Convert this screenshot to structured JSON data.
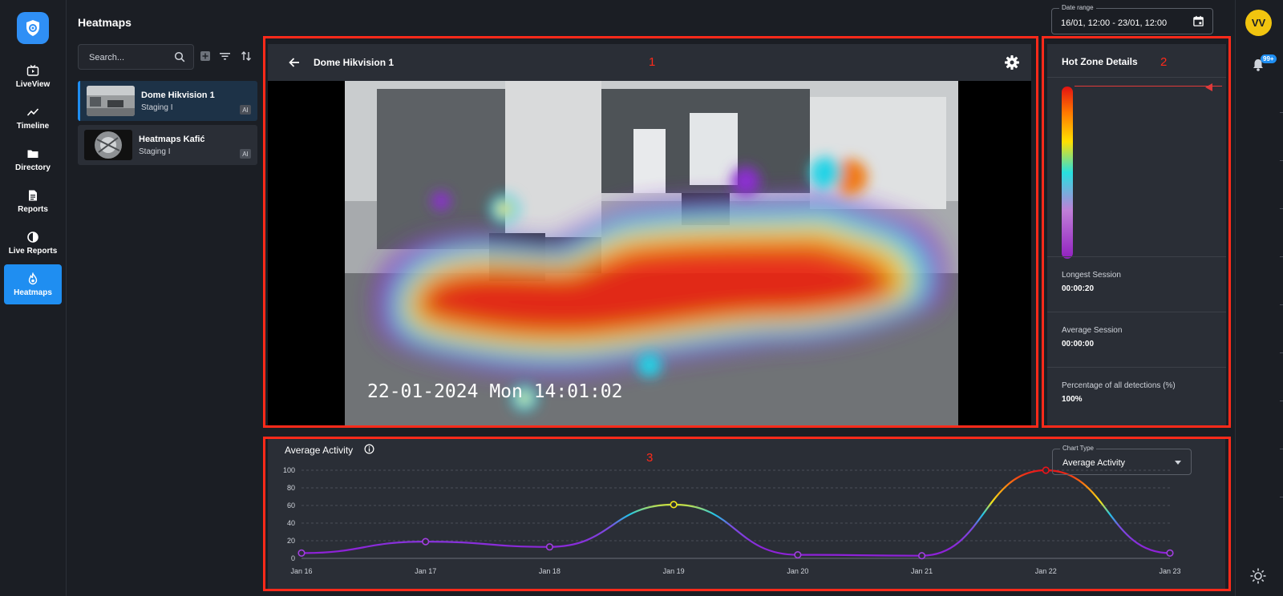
{
  "page": {
    "title": "Heatmaps"
  },
  "nav": [
    {
      "label": "LiveView",
      "icon": "tv-icon"
    },
    {
      "label": "Timeline",
      "icon": "trend-icon"
    },
    {
      "label": "Directory",
      "icon": "folder-icon"
    },
    {
      "label": "Reports",
      "icon": "document-icon"
    },
    {
      "label": "Live Reports",
      "icon": "pie-icon"
    },
    {
      "label": "Heatmaps",
      "icon": "flame-icon",
      "active": true
    }
  ],
  "date_range": {
    "label": "Date range",
    "value": "16/01, 12:00 - 23/01, 12:00"
  },
  "user": {
    "initials": "VV",
    "notifications": "99+"
  },
  "search": {
    "placeholder": "Search..."
  },
  "cameras": [
    {
      "name": "Dome Hikvision 1",
      "site": "Staging I",
      "badge": "AI",
      "selected": true
    },
    {
      "name": "Heatmaps Kafić",
      "site": "Staging I",
      "badge": "AI",
      "selected": false
    }
  ],
  "video": {
    "title": "Dome Hikvision 1",
    "osd": "22-01-2024 Mon 14:01:02"
  },
  "hot_zone": {
    "title": "Hot Zone Details",
    "stats": [
      {
        "label": "Longest Session",
        "value": "00:00:20"
      },
      {
        "label": "Average Session",
        "value": "00:00:00"
      },
      {
        "label": "Percentage of all detections (%)",
        "value": "100%"
      }
    ]
  },
  "chart_panel": {
    "title": "Average Activity",
    "chart_type_label": "Chart Type",
    "chart_type_value": "Average Activity"
  },
  "annotations": {
    "box1": "1",
    "box2": "2",
    "box3": "3"
  },
  "colors": {
    "accent": "#1f8ef1",
    "annotation": "#ff2a1a",
    "panel": "#2a2e36"
  },
  "chart_data": {
    "type": "line",
    "title": "Average Activity",
    "categories": [
      "Jan 16",
      "Jan 17",
      "Jan 18",
      "Jan 19",
      "Jan 20",
      "Jan 21",
      "Jan 22",
      "Jan 23"
    ],
    "values": [
      6,
      19,
      13,
      61,
      4,
      3,
      100,
      6
    ],
    "ylim": [
      0,
      100
    ],
    "yticks": [
      0,
      20,
      40,
      60,
      80,
      100
    ],
    "grid": true,
    "xlabel": "",
    "ylabel": ""
  }
}
